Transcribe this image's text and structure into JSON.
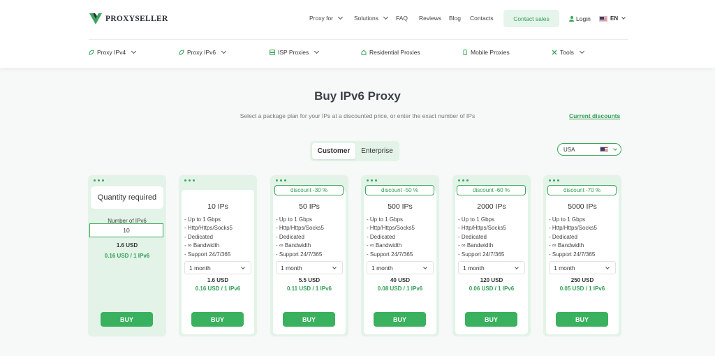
{
  "brand": {
    "name": "PROXYSELLER"
  },
  "topnav": {
    "proxy_for": "Proxy for",
    "solutions": "Solutions",
    "faq": "FAQ",
    "reviews": "Reviews",
    "blog": "Blog",
    "contacts": "Contacts",
    "contact_sales": "Contact sales",
    "login": "Login",
    "language": "EN"
  },
  "subnav": {
    "items": [
      {
        "label": "Proxy IPv4",
        "icon": "leaf-icon",
        "dropdown": true
      },
      {
        "label": "Proxy IPv6",
        "icon": "leaf-icon",
        "dropdown": true
      },
      {
        "label": "ISP Proxies",
        "icon": "server-icon",
        "dropdown": true
      },
      {
        "label": "Residential Proxies",
        "icon": "house-icon",
        "dropdown": false
      },
      {
        "label": "Mobile Proxies",
        "icon": "phone-icon",
        "dropdown": false
      },
      {
        "label": "Tools",
        "icon": "tools-icon",
        "dropdown": true
      }
    ]
  },
  "main": {
    "title": "Buy IPv6 Proxy",
    "subtitle": "Select a package plan for your IPs at a discounted price, or enter the exact number of IPs",
    "discounts_link": "Current discounts",
    "toggle": {
      "active": "Customer",
      "other": "Enterprise"
    },
    "country": "USA"
  },
  "custom_card": {
    "heading": "Quantity required",
    "label": "Number of IPv6",
    "value": "10",
    "total": "1.6 USD",
    "per_ip": "0.16 USD / 1 IPv6",
    "buy": "BUY"
  },
  "features": [
    "- Up to 1 Gbps",
    "- Http/Https/Socks5",
    "- Dedicated",
    "- ∞ Bandwidth",
    "- Support 24/7/365"
  ],
  "plans": [
    {
      "badge": "",
      "title": "10 IPs",
      "period": "1 month",
      "price": "1.6 USD",
      "per_ip": "0.16 USD / 1 IPv6",
      "buy": "BUY"
    },
    {
      "badge": "discount -30 %",
      "title": "50 IPs",
      "period": "1 month",
      "price": "5.5 USD",
      "per_ip": "0.11 USD / 1 IPv6",
      "buy": "BUY"
    },
    {
      "badge": "discount -50 %",
      "title": "500 IPs",
      "period": "1 month",
      "price": "40 USD",
      "per_ip": "0.08 USD / 1 IPv6",
      "buy": "BUY"
    },
    {
      "badge": "discount -60 %",
      "title": "2000 IPs",
      "period": "1 month",
      "price": "120 USD",
      "per_ip": "0.06 USD / 1 IPv6",
      "buy": "BUY"
    },
    {
      "badge": "discount -70 %",
      "title": "5000 IPs",
      "period": "1 month",
      "price": "250 USD",
      "per_ip": "0.05 USD / 1 IPv6",
      "buy": "BUY"
    }
  ],
  "colors": {
    "accent": "#3ab15e",
    "accent_text": "#2f9e54",
    "card_bg": "#e3f3e8"
  }
}
